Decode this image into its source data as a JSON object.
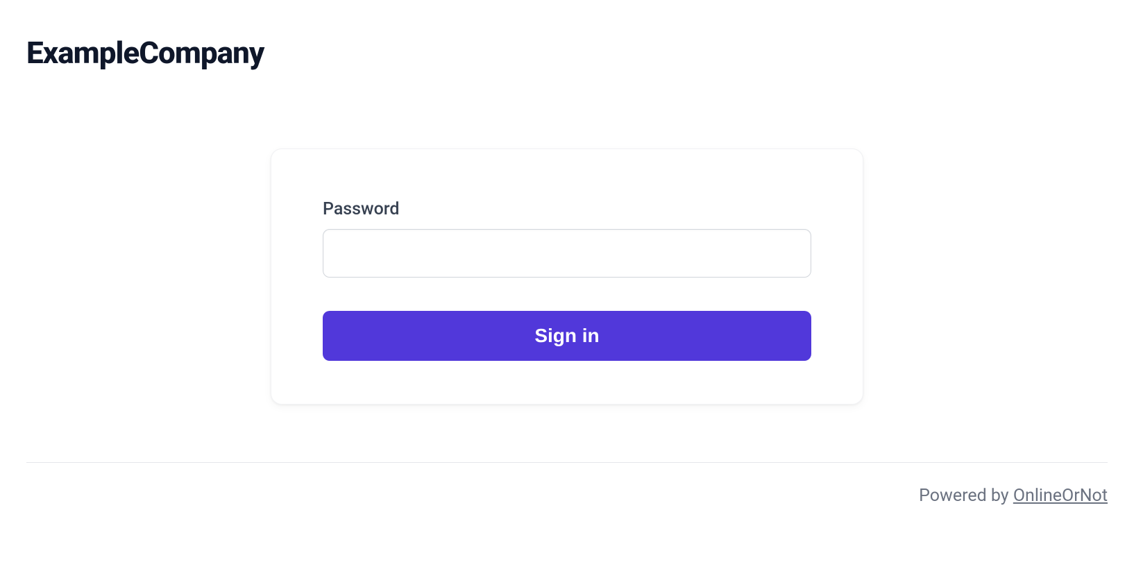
{
  "brand": "ExampleCompany",
  "form": {
    "password_label": "Password",
    "password_value": "",
    "signin_label": "Sign in"
  },
  "footer": {
    "prefix": "Powered by ",
    "link_text": "OnlineOrNot"
  }
}
